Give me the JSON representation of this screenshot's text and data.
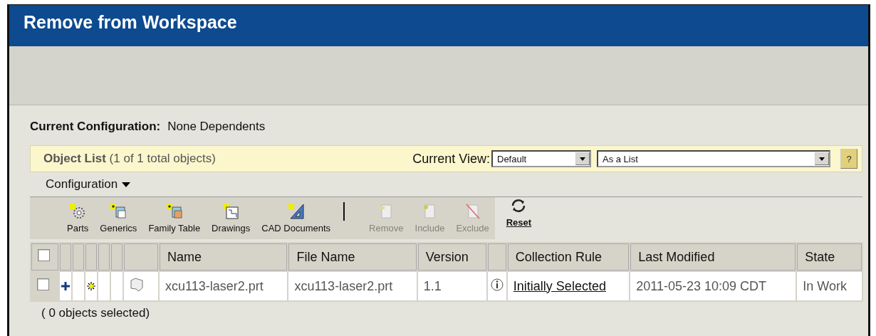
{
  "window": {
    "title": "Remove from Workspace"
  },
  "configuration": {
    "label": "Current Configuration:",
    "value": "None Dependents"
  },
  "object_list": {
    "title": "Object List",
    "count": "(1 of 1 total objects)",
    "view_label": "Current View:",
    "view_select": "Default",
    "layout_select": "As a List",
    "help": "?"
  },
  "menu": {
    "label": "Configuration"
  },
  "toolbar": [
    {
      "kind": "parts",
      "label": "Parts",
      "disabled": false
    },
    {
      "kind": "generics",
      "label": "Generics",
      "disabled": false
    },
    {
      "kind": "family",
      "label": "Family Table",
      "disabled": false
    },
    {
      "kind": "drawings",
      "label": "Drawings",
      "disabled": false
    },
    {
      "kind": "cad",
      "label": "CAD Documents",
      "disabled": false
    },
    {
      "kind": "separator"
    },
    {
      "kind": "remove",
      "label": "Remove",
      "disabled": true
    },
    {
      "kind": "include",
      "label": "Include",
      "disabled": true
    },
    {
      "kind": "exclude",
      "label": "Exclude",
      "disabled": true
    },
    {
      "kind": "reset",
      "label": "Reset",
      "disabled": false
    }
  ],
  "table": {
    "select_all": {
      "checked": false
    },
    "columns": [
      "Name",
      "File Name",
      "Version",
      "Collection Rule",
      "Last Modified",
      "State"
    ],
    "rows": [
      {
        "checked": false,
        "name": "xcu113-laser2.prt",
        "file_name": "xcu113-laser2.prt",
        "version": "1.1",
        "collection_rule": "Initially Selected",
        "last_modified": "2011-05-23 10:09 CDT",
        "state": "In Work"
      }
    ]
  },
  "status": "( 0 objects selected)"
}
